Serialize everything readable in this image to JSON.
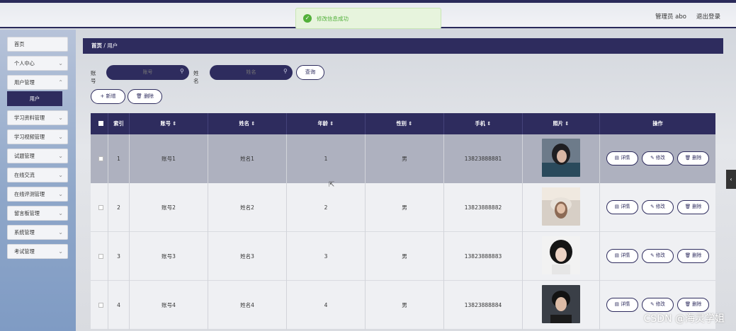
{
  "topbar": {
    "user_label": "管理员 abo",
    "logout_label": "退出登录"
  },
  "toast": {
    "message": "修改信息成功",
    "icon": "check-circle-icon",
    "color": "#52b03a"
  },
  "sidebar": {
    "items": [
      {
        "label": "首页",
        "has_chevron": false
      },
      {
        "label": "个人中心",
        "has_chevron": true
      },
      {
        "label": "用户管理",
        "has_chevron": true,
        "expanded": true
      },
      {
        "label": "学习资料管理",
        "has_chevron": true
      },
      {
        "label": "学习视频管理",
        "has_chevron": true
      },
      {
        "label": "试题管理",
        "has_chevron": true
      },
      {
        "label": "在线交流",
        "has_chevron": true
      },
      {
        "label": "在线评测管理",
        "has_chevron": true
      },
      {
        "label": "留言板管理",
        "has_chevron": true
      },
      {
        "label": "系统管理",
        "has_chevron": true
      },
      {
        "label": "考试管理",
        "has_chevron": true
      }
    ],
    "active_sub": "用户"
  },
  "breadcrumb": {
    "home": "首页",
    "sep": "/",
    "current": "用户"
  },
  "search": {
    "account_label": "账号",
    "account_placeholder": "账号",
    "name_label": "姓名",
    "name_placeholder": "姓名",
    "query_label": "查询"
  },
  "actions": {
    "add_label": "+ 新增",
    "delete_label": "删除"
  },
  "table": {
    "headers": [
      "索引",
      "账号 ⇕",
      "姓名 ⇕",
      "年龄 ⇕",
      "性别 ⇕",
      "手机 ⇕",
      "照片 ⇕",
      "操作"
    ],
    "rows": [
      {
        "index": "1",
        "account": "账号1",
        "name": "姓名1",
        "age": "1",
        "gender": "男",
        "phone": "13823888881"
      },
      {
        "index": "2",
        "account": "账号2",
        "name": "姓名2",
        "age": "2",
        "gender": "男",
        "phone": "13823888882"
      },
      {
        "index": "3",
        "account": "账号3",
        "name": "姓名3",
        "age": "3",
        "gender": "男",
        "phone": "13823888883"
      },
      {
        "index": "4",
        "account": "账号4",
        "name": "姓名4",
        "age": "4",
        "gender": "男",
        "phone": "13823888884"
      }
    ],
    "op_labels": {
      "detail": "详情",
      "edit": "修改",
      "delete": "删除"
    }
  },
  "watermark": "CSDN @海灵学姐",
  "colors": {
    "primary": "#2e2c5e",
    "toast_green": "#52b03a",
    "selected_row": "#aeb1bf"
  }
}
